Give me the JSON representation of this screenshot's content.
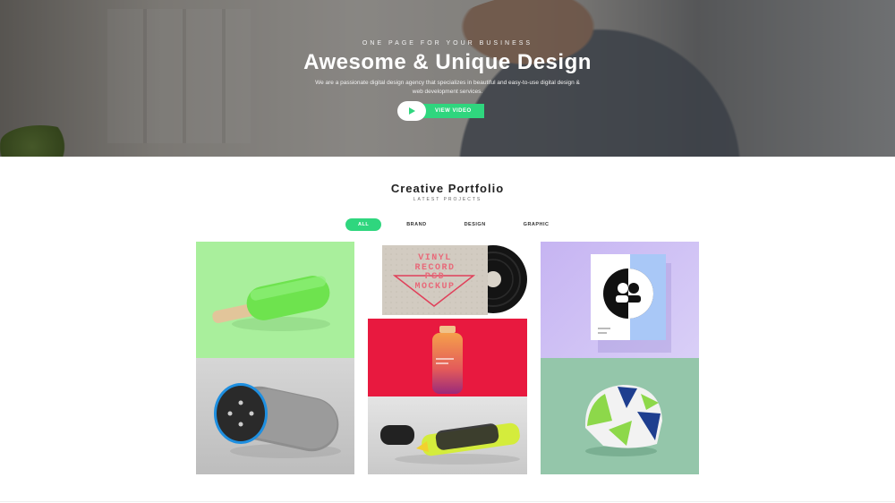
{
  "hero": {
    "tagline": "ONE PAGE FOR YOUR BUSINESS",
    "title": "Awesome & Unique Design",
    "description": "We are a passionate digital design agency that specializes in beautiful and easy-to-use digital design & web development services.",
    "video_button_label": "VIEW VIDEO"
  },
  "portfolio": {
    "title": "Creative Portfolio",
    "subtitle": "LATEST PROJECTS",
    "filters": [
      "ALL",
      "BRAND",
      "DESIGN",
      "GRAPHIC"
    ],
    "active_filter": "ALL",
    "vinyl_mockup_text": [
      "VINYL",
      "RECORD",
      "PSD",
      "MOCKUP"
    ]
  },
  "colors": {
    "accent": "#2fd67e"
  }
}
